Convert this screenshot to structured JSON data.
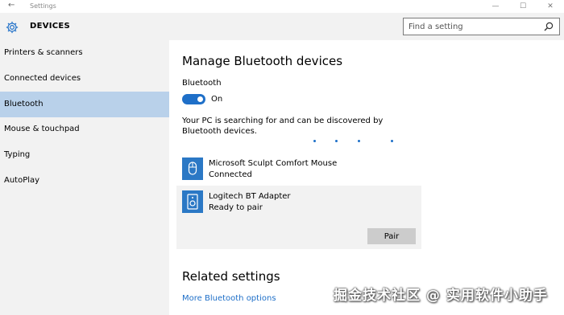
{
  "window": {
    "title": "Settings",
    "back_glyph": "←",
    "minimize_glyph": "—",
    "maximize_glyph": "☐",
    "close_glyph": "✕"
  },
  "header": {
    "title": "DEVICES",
    "search_placeholder": "Find a setting"
  },
  "sidebar": {
    "items": [
      {
        "label": "Printers & scanners"
      },
      {
        "label": "Connected devices"
      },
      {
        "label": "Bluetooth",
        "active": true
      },
      {
        "label": "Mouse & touchpad"
      },
      {
        "label": "Typing"
      },
      {
        "label": "AutoPlay"
      }
    ]
  },
  "main": {
    "heading": "Manage Bluetooth devices",
    "bluetooth_label": "Bluetooth",
    "toggle_state": "On",
    "description": "Your PC is searching for and can be discovered by Bluetooth devices.",
    "devices": [
      {
        "name": "Microsoft Sculpt Comfort Mouse",
        "status": "Connected",
        "icon": "mouse-icon"
      },
      {
        "name": "Logitech BT Adapter",
        "status": "Ready to pair",
        "icon": "speaker-icon",
        "action": "Pair"
      }
    ],
    "related_heading": "Related settings",
    "related_link": "More Bluetooth options"
  },
  "watermark": "掘金技术社区 @ 实用软件小助手",
  "colors": {
    "accent": "#1e6fc8",
    "sidebar_bg": "#f2f2f2",
    "active_bg": "#b9d1ea",
    "icon_bg": "#2b78c5"
  }
}
